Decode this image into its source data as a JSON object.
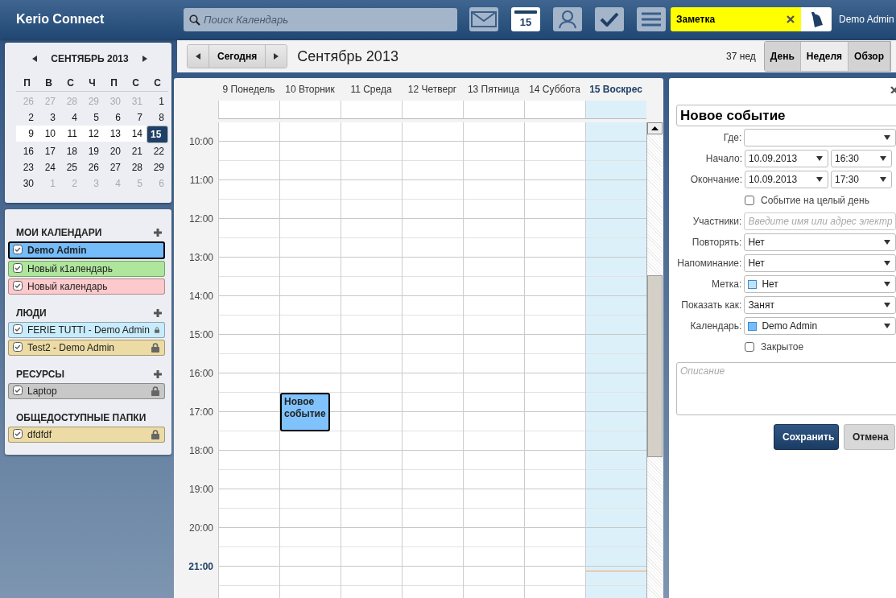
{
  "app": {
    "title": "Kerio Connect"
  },
  "search": {
    "placeholder": "Поиск Календарь"
  },
  "modules": [
    {
      "kind": "mail",
      "selected": false
    },
    {
      "kind": "calendar",
      "label": "15",
      "selected": true
    },
    {
      "kind": "contacts",
      "selected": false
    },
    {
      "kind": "tasks",
      "selected": false
    },
    {
      "kind": "menu",
      "selected": false
    }
  ],
  "note_field": {
    "value": "Заметка"
  },
  "user": {
    "name": "Demo Admin"
  },
  "mini_calendar": {
    "title": "СЕНТЯБРЬ 2013",
    "weekdays": [
      "П",
      "В",
      "С",
      "Ч",
      "П",
      "С",
      "С"
    ],
    "weeks": [
      {
        "current": false,
        "days": [
          {
            "label": "26",
            "other_month": true,
            "selected": false
          },
          {
            "label": "27",
            "other_month": true,
            "selected": false
          },
          {
            "label": "28",
            "other_month": true,
            "selected": false
          },
          {
            "label": "29",
            "other_month": true,
            "selected": false
          },
          {
            "label": "30",
            "other_month": true,
            "selected": false
          },
          {
            "label": "31",
            "other_month": true,
            "selected": false
          },
          {
            "label": "1",
            "other_month": false,
            "selected": false
          }
        ]
      },
      {
        "current": false,
        "days": [
          {
            "label": "2",
            "other_month": false,
            "selected": false
          },
          {
            "label": "3",
            "other_month": false,
            "selected": false
          },
          {
            "label": "4",
            "other_month": false,
            "selected": false
          },
          {
            "label": "5",
            "other_month": false,
            "selected": false
          },
          {
            "label": "6",
            "other_month": false,
            "selected": false
          },
          {
            "label": "7",
            "other_month": false,
            "selected": false
          },
          {
            "label": "8",
            "other_month": false,
            "selected": false
          }
        ]
      },
      {
        "current": true,
        "days": [
          {
            "label": "9",
            "other_month": false,
            "selected": false
          },
          {
            "label": "10",
            "other_month": false,
            "selected": false
          },
          {
            "label": "11",
            "other_month": false,
            "selected": false
          },
          {
            "label": "12",
            "other_month": false,
            "selected": false
          },
          {
            "label": "13",
            "other_month": false,
            "selected": false
          },
          {
            "label": "14",
            "other_month": false,
            "selected": false
          },
          {
            "label": "15",
            "other_month": false,
            "selected": true
          }
        ]
      },
      {
        "current": false,
        "days": [
          {
            "label": "16",
            "other_month": false,
            "selected": false
          },
          {
            "label": "17",
            "other_month": false,
            "selected": false
          },
          {
            "label": "18",
            "other_month": false,
            "selected": false
          },
          {
            "label": "19",
            "other_month": false,
            "selected": false
          },
          {
            "label": "20",
            "other_month": false,
            "selected": false
          },
          {
            "label": "21",
            "other_month": false,
            "selected": false
          },
          {
            "label": "22",
            "other_month": false,
            "selected": false
          }
        ]
      },
      {
        "current": false,
        "days": [
          {
            "label": "23",
            "other_month": false,
            "selected": false
          },
          {
            "label": "24",
            "other_month": false,
            "selected": false
          },
          {
            "label": "25",
            "other_month": false,
            "selected": false
          },
          {
            "label": "26",
            "other_month": false,
            "selected": false
          },
          {
            "label": "27",
            "other_month": false,
            "selected": false
          },
          {
            "label": "28",
            "other_month": false,
            "selected": false
          },
          {
            "label": "29",
            "other_month": false,
            "selected": false
          }
        ]
      },
      {
        "current": false,
        "days": [
          {
            "label": "30",
            "other_month": false,
            "selected": false
          },
          {
            "label": "1",
            "other_month": true,
            "selected": false
          },
          {
            "label": "2",
            "other_month": true,
            "selected": false
          },
          {
            "label": "3",
            "other_month": true,
            "selected": false
          },
          {
            "label": "4",
            "other_month": true,
            "selected": false
          },
          {
            "label": "5",
            "other_month": true,
            "selected": false
          },
          {
            "label": "6",
            "other_month": true,
            "selected": false
          }
        ]
      }
    ]
  },
  "calendar_groups": [
    {
      "title": "МОИ КАЛЕНДАРИ",
      "can_add": true,
      "items": [
        {
          "name": "Demo Admin",
          "color": "#74bcfa",
          "checked": true,
          "selected": true,
          "locked": false
        },
        {
          "name": "Новый к1алендарь",
          "color": "#aee69c",
          "checked": true,
          "selected": false,
          "locked": false
        },
        {
          "name": "Новый календарь",
          "color": "#fcc9cc",
          "checked": true,
          "selected": false,
          "locked": false
        }
      ]
    },
    {
      "title": "ЛЮДИ",
      "can_add": true,
      "items": [
        {
          "name": "FERIE TUTTI - Demo Admin",
          "color": "#c9ecfc",
          "checked": true,
          "selected": false,
          "locked": true
        },
        {
          "name": "Test2 - Demo Admin",
          "color": "#ecdba4",
          "checked": true,
          "selected": false,
          "locked": true
        }
      ]
    },
    {
      "title": "РЕСУРСЫ",
      "can_add": true,
      "items": [
        {
          "name": "Laptop",
          "color": "#c8c8c8",
          "checked": true,
          "selected": false,
          "locked": true
        }
      ]
    },
    {
      "title": "ОБЩЕДОСТУПНЫЕ ПАПКИ",
      "can_add": false,
      "items": [
        {
          "name": "dfdfdf",
          "color": "#ecdba4",
          "checked": true,
          "selected": false,
          "locked": true
        }
      ]
    }
  ],
  "toolbar": {
    "today": "Сегодня",
    "title": "Сентябрь 2013",
    "week": "37 нед",
    "views": [
      {
        "label": "День",
        "selected": false
      },
      {
        "label": "Неделя",
        "selected": true
      },
      {
        "label": "Обзор",
        "selected": false
      }
    ]
  },
  "week_view": {
    "days": [
      {
        "label": "9 Понедель",
        "today": false
      },
      {
        "label": "10 Вторник",
        "today": false,
        "events": [
          {
            "title": "Новое событие",
            "color": "#80c2fc"
          }
        ]
      },
      {
        "label": "11 Среда",
        "today": false
      },
      {
        "label": "12 Четверг",
        "today": false
      },
      {
        "label": "13 Пятница",
        "today": false
      },
      {
        "label": "14 Суббота",
        "today": false
      },
      {
        "label": "15 Воскрес",
        "today": true
      }
    ],
    "hours": [
      {
        "label": "10:00",
        "current": false
      },
      {
        "label": "11:00",
        "current": false
      },
      {
        "label": "12:00",
        "current": false
      },
      {
        "label": "13:00",
        "current": false
      },
      {
        "label": "14:00",
        "current": false
      },
      {
        "label": "15:00",
        "current": false
      },
      {
        "label": "16:00",
        "current": false
      },
      {
        "label": "17:00",
        "current": false
      },
      {
        "label": "18:00",
        "current": false
      },
      {
        "label": "19:00",
        "current": false
      },
      {
        "label": "20:00",
        "current": false
      },
      {
        "label": "21:00",
        "current": true
      }
    ]
  },
  "event_form": {
    "title": "Новое событие",
    "fields": [
      {
        "kind": "select",
        "label": "Где:"
      },
      {
        "kind": "datetime",
        "label": "Начало:",
        "date": "10.09.2013",
        "time": "16:30"
      },
      {
        "kind": "datetime",
        "label": "Окончание:",
        "date": "10.09.2013",
        "time": "17:30"
      },
      {
        "kind": "checkbox",
        "label": "Событие на целый день",
        "checked": false
      },
      {
        "kind": "text",
        "label": "Участники:",
        "placeholder": "Введите имя или адрес электр"
      },
      {
        "kind": "select",
        "label": "Повторять:",
        "value": "Нет"
      },
      {
        "kind": "select",
        "label": "Напоминание:",
        "value": "Нет"
      },
      {
        "kind": "select",
        "label": "Метка:",
        "value": "Нет",
        "color": "#bfe3f7"
      },
      {
        "kind": "select",
        "label": "Показать как:",
        "value": "Занят"
      },
      {
        "kind": "select",
        "label": "Календарь:",
        "value": "Demo Admin",
        "color": "#74bcfa"
      },
      {
        "kind": "checkbox",
        "label": "Закрытое",
        "checked": false
      }
    ],
    "description": {
      "placeholder": "Описание"
    },
    "buttons": [
      {
        "label": "Сохранить",
        "kind": "primary"
      },
      {
        "label": "Отмена",
        "kind": "secondary"
      }
    ]
  }
}
